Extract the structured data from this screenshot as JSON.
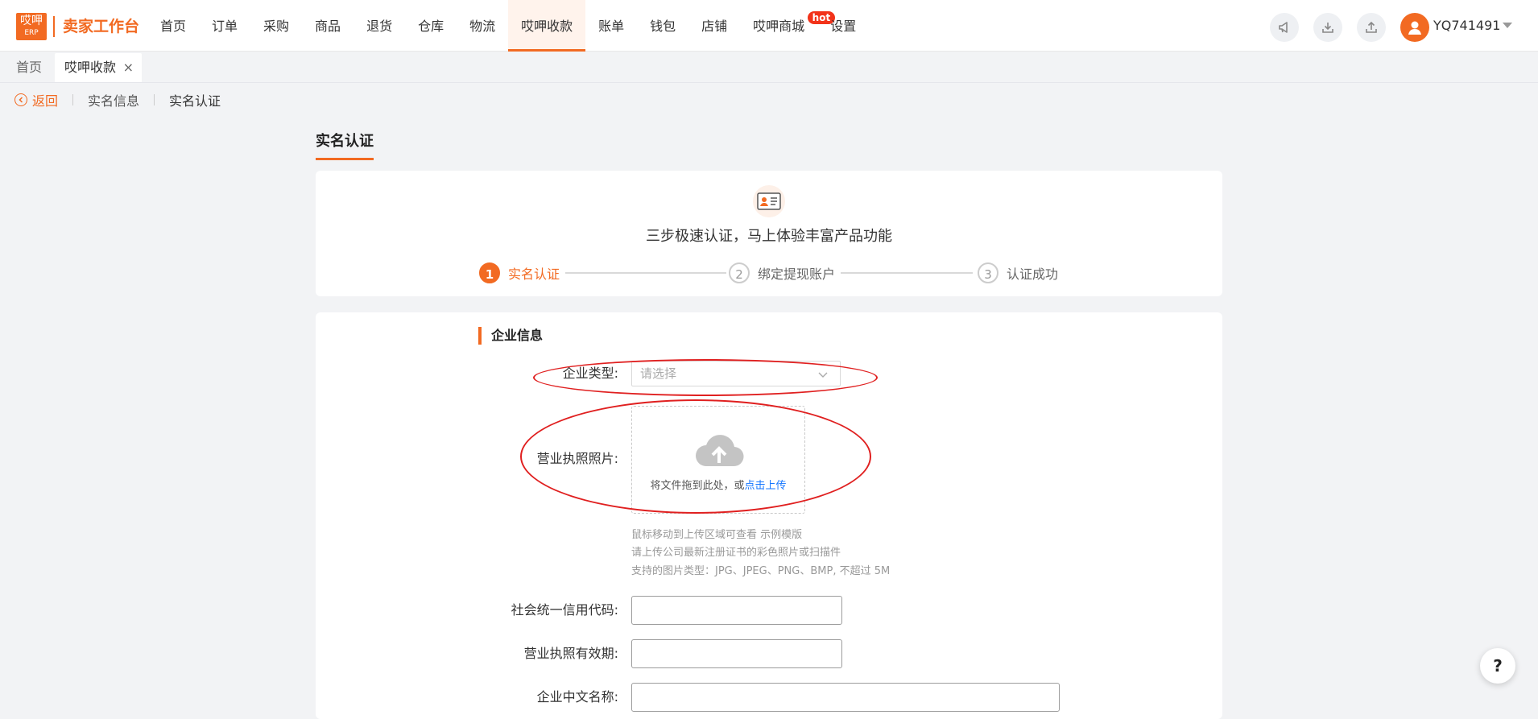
{
  "app": {
    "logo_top": "哎呷",
    "logo_bottom": "ERP",
    "brand": "卖家工作台",
    "username": "YQ741491"
  },
  "nav": {
    "items": [
      {
        "label": "首页"
      },
      {
        "label": "订单"
      },
      {
        "label": "采购"
      },
      {
        "label": "商品"
      },
      {
        "label": "退货"
      },
      {
        "label": "仓库"
      },
      {
        "label": "物流"
      },
      {
        "label": "哎呷收款",
        "active": true
      },
      {
        "label": "账单"
      },
      {
        "label": "钱包"
      },
      {
        "label": "店铺"
      },
      {
        "label": "哎呷商城",
        "badge": "hot"
      },
      {
        "label": "设置"
      }
    ],
    "active_index": 7,
    "accent_color": "#f26a22"
  },
  "header_icons": [
    "megaphone-icon",
    "download-icon",
    "upload-icon",
    "user-avatar-icon",
    "chevron-down-icon"
  ],
  "tabs": {
    "home": "首页",
    "current": "哎呷收款",
    "close": "×"
  },
  "breadcrumb": {
    "back": "返回",
    "level1": "实名信息",
    "level2": "实名认证"
  },
  "page": {
    "title": "实名认证",
    "slogan": "三步极速认证，马上体验丰富产品功能"
  },
  "steps": [
    {
      "num": "1",
      "label": "实名认证",
      "active": true
    },
    {
      "num": "2",
      "label": "绑定提现账户",
      "active": false
    },
    {
      "num": "3",
      "label": "认证成功",
      "active": false
    }
  ],
  "form": {
    "section_title": "企业信息",
    "company_type_label": "企业类型:",
    "company_type_placeholder": "请选择",
    "license_photo_label": "营业执照照片:",
    "upload_text": "将文件拖到此处，或",
    "upload_link": "点击上传",
    "hints": [
      "鼠标移动到上传区域可查看 示例模版",
      "请上传公司最新注册证书的彩色照片或扫描件",
      "支持的图片类型：JPG、JPEG、PNG、BMP, 不超过 5M"
    ],
    "credit_code_label": "社会统一信用代码:",
    "license_validity_label": "营业执照有效期:",
    "company_cn_name_label": "企业中文名称:"
  },
  "help": "?",
  "annotation_color": "#e02020"
}
